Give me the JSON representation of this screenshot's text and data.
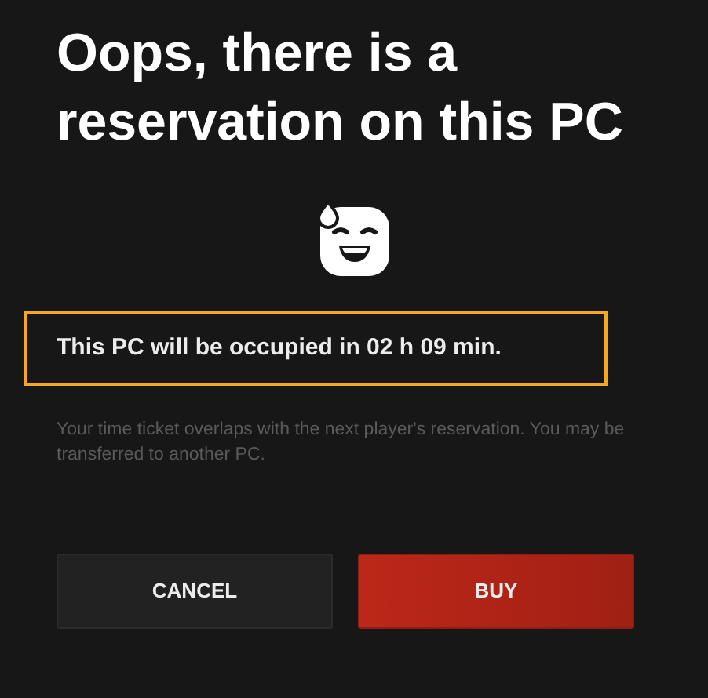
{
  "title": "Oops, there is a reservation on this PC",
  "notice": {
    "text": "This PC will be occupied in 02 h 09 min.",
    "highlighted": true
  },
  "description": "Your time ticket overlaps with the next player's reservation. You may be transferred to another PC.",
  "buttons": [
    {
      "label": "CANCEL",
      "kind": "secondary"
    },
    {
      "label": "BUY",
      "kind": "primary"
    }
  ]
}
